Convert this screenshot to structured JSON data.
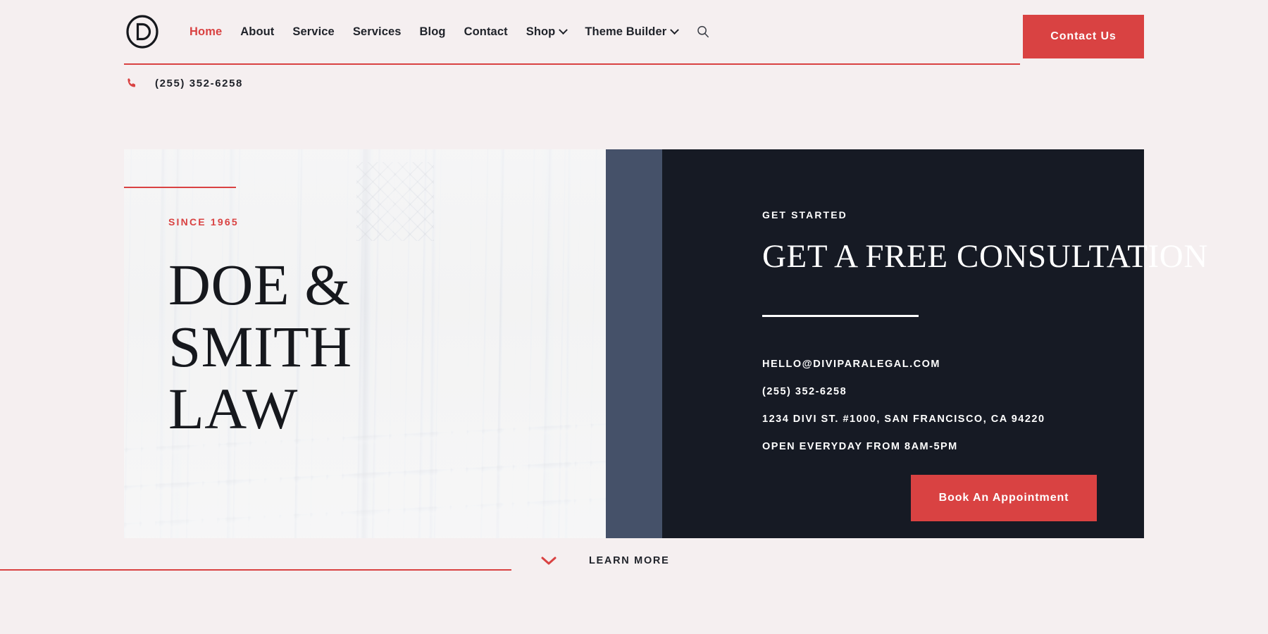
{
  "theme": {
    "accent_red": "#d94242",
    "page_background": "#f5eff0",
    "panel_dark": "#161a24",
    "panel_blue": "#455169",
    "text_dark": "#1f2229"
  },
  "header": {
    "logo_letter": "D",
    "logo_name": "divi-logo",
    "nav_items": [
      {
        "label": "Home",
        "active": true,
        "has_dropdown": false
      },
      {
        "label": "About",
        "active": false,
        "has_dropdown": false
      },
      {
        "label": "Service",
        "active": false,
        "has_dropdown": false
      },
      {
        "label": "Services",
        "active": false,
        "has_dropdown": false
      },
      {
        "label": "Blog",
        "active": false,
        "has_dropdown": false
      },
      {
        "label": "Contact",
        "active": false,
        "has_dropdown": false
      },
      {
        "label": "Shop",
        "active": false,
        "has_dropdown": true
      },
      {
        "label": "Theme Builder",
        "active": false,
        "has_dropdown": true
      }
    ],
    "search_icon": "search-icon",
    "contact_button_label": "Contact Us"
  },
  "phone_bar": {
    "icon": "phone-icon",
    "number": "(255) 352-6258"
  },
  "hero": {
    "eyebrow": "SINCE 1965",
    "title_line1": "DOE & SMITH",
    "title_line2": "LAW"
  },
  "panel": {
    "eyebrow": "GET STARTED",
    "title": "GET A FREE CONSULTATION",
    "details": [
      "HELLO@DIVIPARALEGAL.COM",
      "(255) 352-6258",
      "1234 DIVI ST. #1000, SAN FRANCISCO, CA 94220",
      "OPEN EVERYDAY FROM 8AM-5PM"
    ],
    "button_label": "Book An Appointment"
  },
  "footer_bar": {
    "chevron_icon": "chevron-down-icon",
    "learn_more_label": "LEARN MORE"
  }
}
